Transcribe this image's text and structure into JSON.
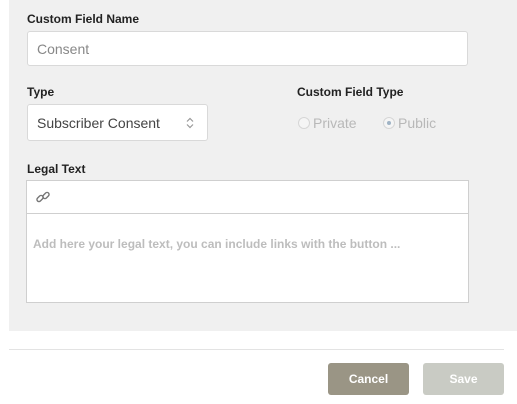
{
  "custom_field_name": {
    "label": "Custom Field Name",
    "placeholder": "Consent"
  },
  "type": {
    "label": "Type",
    "selected": "Subscriber Consent"
  },
  "custom_field_type": {
    "label": "Custom Field Type",
    "options": [
      "Private",
      "Public"
    ],
    "selected": "Public"
  },
  "legal_text": {
    "label": "Legal Text",
    "placeholder": "Add here your legal text, you can include links with the button ..."
  },
  "footer": {
    "cancel_label": "Cancel",
    "save_label": "Save"
  },
  "colors": {
    "panel_bg": "#f0f0f0",
    "cancel_bg": "#9a9585",
    "save_bg": "#c9cbc4"
  }
}
